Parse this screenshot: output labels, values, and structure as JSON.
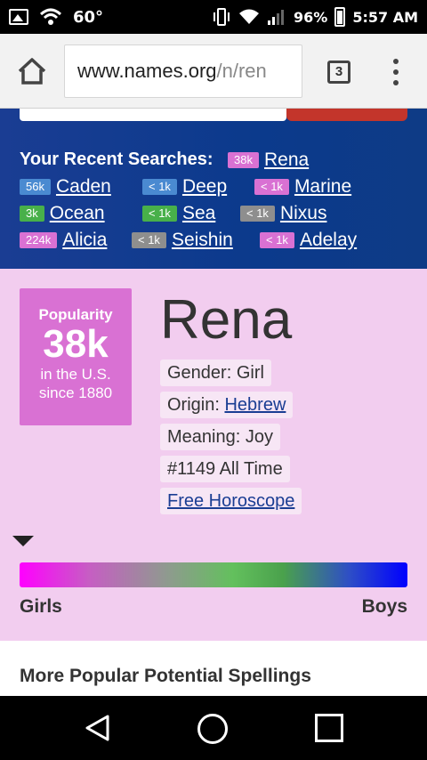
{
  "status_bar": {
    "temperature": "60°",
    "battery": "96%",
    "time": "5:57 AM"
  },
  "browser": {
    "url_host": "www.names.org",
    "url_path": "/n/ren",
    "tab_count": "3"
  },
  "recent_searches": {
    "title": "Your Recent Searches:",
    "items": [
      {
        "badge": "38k",
        "name": "Rena",
        "badge_color": "#d971d3"
      },
      {
        "badge": "56k",
        "name": "Caden",
        "badge_color": "#4a8ad1"
      },
      {
        "badge": "< 1k",
        "name": "Deep",
        "badge_color": "#4a8ad1"
      },
      {
        "badge": "< 1k",
        "name": "Marine",
        "badge_color": "#d971d3"
      },
      {
        "badge": "3k",
        "name": "Ocean",
        "badge_color": "#48b04a"
      },
      {
        "badge": "< 1k",
        "name": "Sea",
        "badge_color": "#48b04a"
      },
      {
        "badge": "< 1k",
        "name": "Nixus",
        "badge_color": "#8e8e8e"
      },
      {
        "badge": "224k",
        "name": "Alicia",
        "badge_color": "#d971d3"
      },
      {
        "badge": "< 1k",
        "name": "Seishin",
        "badge_color": "#8e8e8e"
      },
      {
        "badge": "< 1k",
        "name": "Adelay",
        "badge_color": "#d971d3"
      }
    ]
  },
  "name_card": {
    "popularity_label": "Popularity",
    "popularity_value": "38k",
    "popularity_sub1": "in the U.S.",
    "popularity_sub2": "since 1880",
    "name": "Rena",
    "gender": "Gender: Girl",
    "origin_label": "Origin: ",
    "origin_link": "Hebrew",
    "meaning": "Meaning: Joy",
    "rank": "#1149 All Time",
    "horoscope_link": "Free Horoscope"
  },
  "gender_gauge": {
    "left_label": "Girls",
    "right_label": "Boys"
  },
  "spellings": {
    "title": "More Popular Potential Spellings"
  }
}
